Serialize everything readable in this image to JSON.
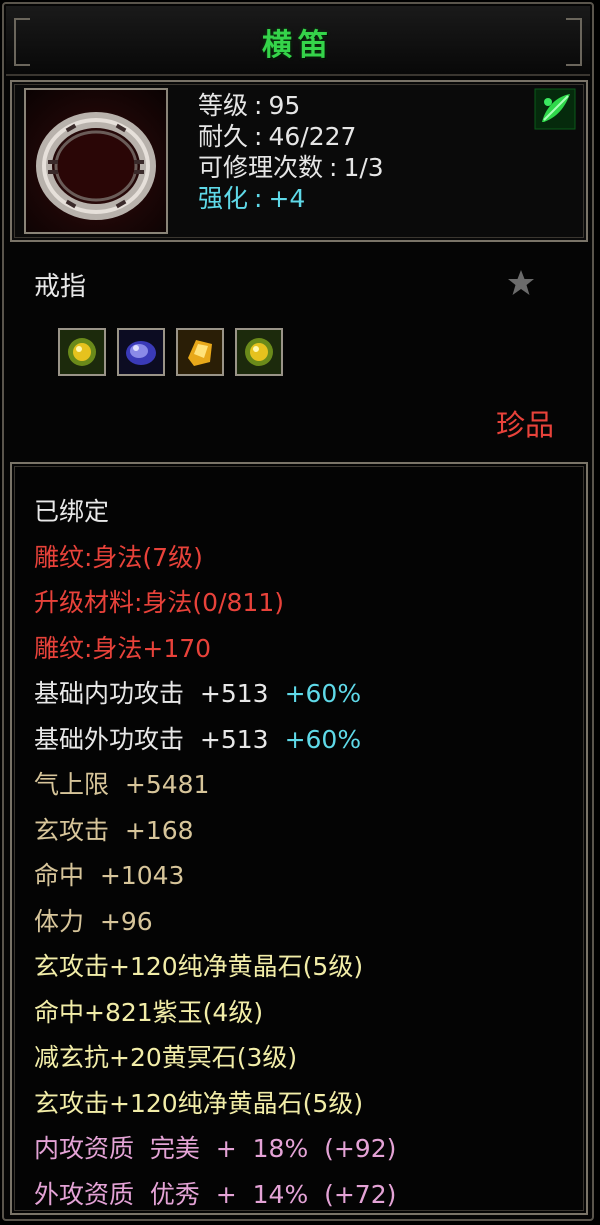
{
  "title": "横笛",
  "item": {
    "level_label": "等级",
    "level_value": "95",
    "durability_label": "耐久",
    "durability_value": "46/227",
    "repair_label": "可修理次数",
    "repair_value": "1/3",
    "enhance_label": "强化",
    "enhance_value": "+4",
    "separator": ":",
    "icon": "ring-icon",
    "badge_icon": "green-leaf-icon"
  },
  "item_type": "戒指",
  "favorite_icon": "star-icon",
  "gem_slots": [
    {
      "icon": "yellow-green-gem-icon"
    },
    {
      "icon": "purple-jade-gem-icon"
    },
    {
      "icon": "yellow-crystal-gem-icon"
    },
    {
      "icon": "yellow-green-gem-icon"
    }
  ],
  "rarity": "珍品",
  "attributes": [
    {
      "text": "已绑定",
      "color": "white"
    },
    {
      "text": "雕纹:身法(7级)",
      "color": "red"
    },
    {
      "text": "升级材料:身法(0/811)",
      "color": "red"
    },
    {
      "text": "雕纹:身法+170",
      "color": "red"
    },
    {
      "text": "基础内功攻击  +513",
      "extra": "+60%",
      "color": "white"
    },
    {
      "text": "基础外功攻击  +513",
      "extra": "+60%",
      "color": "white"
    },
    {
      "text": "气上限  +5481",
      "color": "gold"
    },
    {
      "text": "玄攻击  +168",
      "color": "gold"
    },
    {
      "text": "命中  +1043",
      "color": "gold"
    },
    {
      "text": "体力  +96",
      "color": "gold"
    },
    {
      "text": "玄攻击+120纯净黄晶石(5级)",
      "color": "yellow"
    },
    {
      "text": "命中+821紫玉(4级)",
      "color": "yellow"
    },
    {
      "text": "减玄抗+20黄冥石(3级)",
      "color": "yellow"
    },
    {
      "text": "玄攻击+120纯净黄晶石(5级)",
      "color": "yellow"
    },
    {
      "text": "内攻资质  完美  +  18%  (+92)",
      "color": "pink"
    },
    {
      "text": "外攻资质  优秀  +  14%  (+72)",
      "color": "pink"
    }
  ]
}
